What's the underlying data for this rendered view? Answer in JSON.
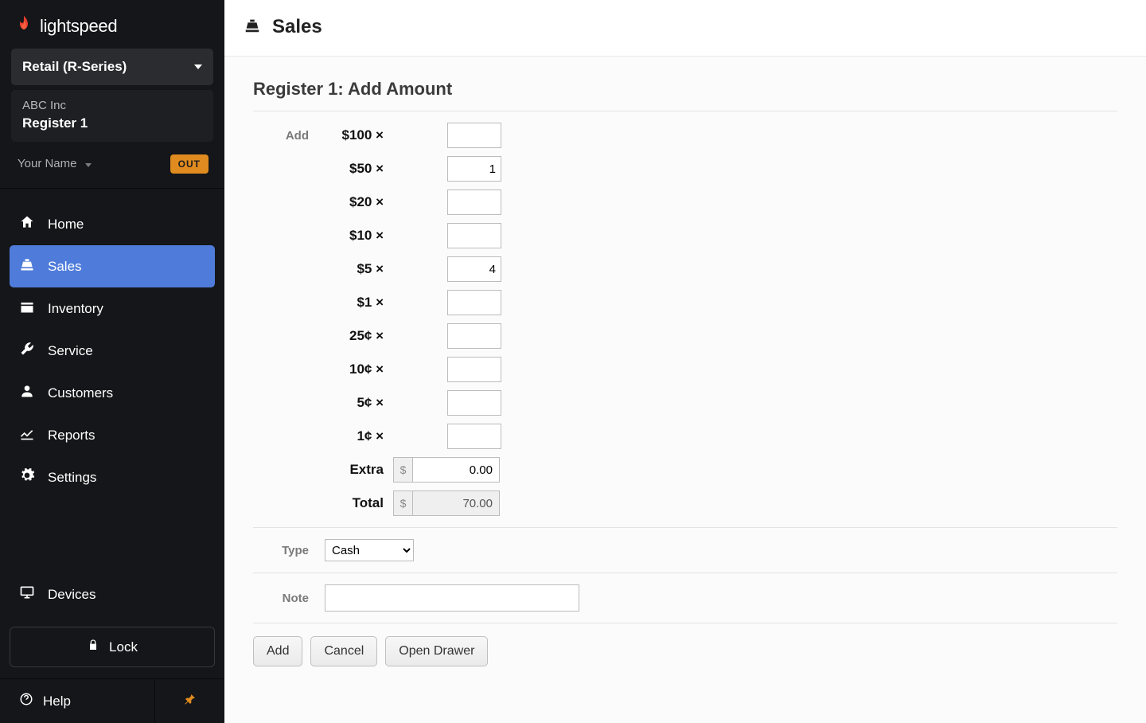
{
  "brand": {
    "name": "lightspeed"
  },
  "series_selector": {
    "label": "Retail (R-Series)"
  },
  "register_info": {
    "company": "ABC Inc",
    "register": "Register 1"
  },
  "user": {
    "name": "Your Name",
    "badge": "OUT"
  },
  "nav": {
    "home": "Home",
    "sales": "Sales",
    "inventory": "Inventory",
    "service": "Service",
    "customers": "Customers",
    "reports": "Reports",
    "settings": "Settings",
    "devices": "Devices",
    "lock": "Lock",
    "help": "Help"
  },
  "header": {
    "title": "Sales"
  },
  "page": {
    "title": "Register 1: Add Amount",
    "add_label": "Add",
    "denominations": [
      {
        "label": "$100 ×",
        "value": ""
      },
      {
        "label": "$50 ×",
        "value": "1"
      },
      {
        "label": "$20 ×",
        "value": ""
      },
      {
        "label": "$10 ×",
        "value": ""
      },
      {
        "label": "$5 ×",
        "value": "4"
      },
      {
        "label": "$1 ×",
        "value": ""
      },
      {
        "label": "25¢ ×",
        "value": ""
      },
      {
        "label": "10¢ ×",
        "value": ""
      },
      {
        "label": "5¢ ×",
        "value": ""
      },
      {
        "label": "1¢ ×",
        "value": ""
      }
    ],
    "extra_label": "Extra",
    "extra_currency": "$",
    "extra_value": "0.00",
    "total_label": "Total",
    "total_currency": "$",
    "total_value": "70.00",
    "type_label": "Type",
    "type_options": [
      "Cash"
    ],
    "type_selected": "Cash",
    "note_label": "Note",
    "note_value": "",
    "buttons": {
      "add": "Add",
      "cancel": "Cancel",
      "open_drawer": "Open Drawer"
    }
  }
}
